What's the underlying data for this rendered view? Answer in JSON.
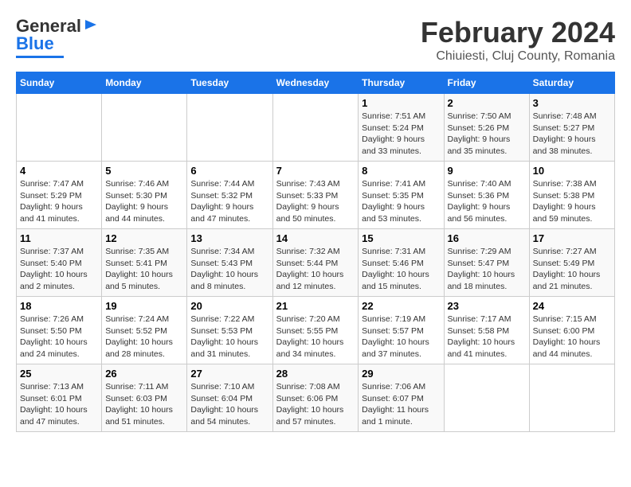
{
  "header": {
    "logo_line1": "General",
    "logo_line2": "Blue",
    "title": "February 2024",
    "subtitle": "Chiuiesti, Cluj County, Romania"
  },
  "weekdays": [
    "Sunday",
    "Monday",
    "Tuesday",
    "Wednesday",
    "Thursday",
    "Friday",
    "Saturday"
  ],
  "weeks": [
    [
      {
        "day": "",
        "info": ""
      },
      {
        "day": "",
        "info": ""
      },
      {
        "day": "",
        "info": ""
      },
      {
        "day": "",
        "info": ""
      },
      {
        "day": "1",
        "info": "Sunrise: 7:51 AM\nSunset: 5:24 PM\nDaylight: 9 hours\nand 33 minutes."
      },
      {
        "day": "2",
        "info": "Sunrise: 7:50 AM\nSunset: 5:26 PM\nDaylight: 9 hours\nand 35 minutes."
      },
      {
        "day": "3",
        "info": "Sunrise: 7:48 AM\nSunset: 5:27 PM\nDaylight: 9 hours\nand 38 minutes."
      }
    ],
    [
      {
        "day": "4",
        "info": "Sunrise: 7:47 AM\nSunset: 5:29 PM\nDaylight: 9 hours\nand 41 minutes."
      },
      {
        "day": "5",
        "info": "Sunrise: 7:46 AM\nSunset: 5:30 PM\nDaylight: 9 hours\nand 44 minutes."
      },
      {
        "day": "6",
        "info": "Sunrise: 7:44 AM\nSunset: 5:32 PM\nDaylight: 9 hours\nand 47 minutes."
      },
      {
        "day": "7",
        "info": "Sunrise: 7:43 AM\nSunset: 5:33 PM\nDaylight: 9 hours\nand 50 minutes."
      },
      {
        "day": "8",
        "info": "Sunrise: 7:41 AM\nSunset: 5:35 PM\nDaylight: 9 hours\nand 53 minutes."
      },
      {
        "day": "9",
        "info": "Sunrise: 7:40 AM\nSunset: 5:36 PM\nDaylight: 9 hours\nand 56 minutes."
      },
      {
        "day": "10",
        "info": "Sunrise: 7:38 AM\nSunset: 5:38 PM\nDaylight: 9 hours\nand 59 minutes."
      }
    ],
    [
      {
        "day": "11",
        "info": "Sunrise: 7:37 AM\nSunset: 5:40 PM\nDaylight: 10 hours\nand 2 minutes."
      },
      {
        "day": "12",
        "info": "Sunrise: 7:35 AM\nSunset: 5:41 PM\nDaylight: 10 hours\nand 5 minutes."
      },
      {
        "day": "13",
        "info": "Sunrise: 7:34 AM\nSunset: 5:43 PM\nDaylight: 10 hours\nand 8 minutes."
      },
      {
        "day": "14",
        "info": "Sunrise: 7:32 AM\nSunset: 5:44 PM\nDaylight: 10 hours\nand 12 minutes."
      },
      {
        "day": "15",
        "info": "Sunrise: 7:31 AM\nSunset: 5:46 PM\nDaylight: 10 hours\nand 15 minutes."
      },
      {
        "day": "16",
        "info": "Sunrise: 7:29 AM\nSunset: 5:47 PM\nDaylight: 10 hours\nand 18 minutes."
      },
      {
        "day": "17",
        "info": "Sunrise: 7:27 AM\nSunset: 5:49 PM\nDaylight: 10 hours\nand 21 minutes."
      }
    ],
    [
      {
        "day": "18",
        "info": "Sunrise: 7:26 AM\nSunset: 5:50 PM\nDaylight: 10 hours\nand 24 minutes."
      },
      {
        "day": "19",
        "info": "Sunrise: 7:24 AM\nSunset: 5:52 PM\nDaylight: 10 hours\nand 28 minutes."
      },
      {
        "day": "20",
        "info": "Sunrise: 7:22 AM\nSunset: 5:53 PM\nDaylight: 10 hours\nand 31 minutes."
      },
      {
        "day": "21",
        "info": "Sunrise: 7:20 AM\nSunset: 5:55 PM\nDaylight: 10 hours\nand 34 minutes."
      },
      {
        "day": "22",
        "info": "Sunrise: 7:19 AM\nSunset: 5:57 PM\nDaylight: 10 hours\nand 37 minutes."
      },
      {
        "day": "23",
        "info": "Sunrise: 7:17 AM\nSunset: 5:58 PM\nDaylight: 10 hours\nand 41 minutes."
      },
      {
        "day": "24",
        "info": "Sunrise: 7:15 AM\nSunset: 6:00 PM\nDaylight: 10 hours\nand 44 minutes."
      }
    ],
    [
      {
        "day": "25",
        "info": "Sunrise: 7:13 AM\nSunset: 6:01 PM\nDaylight: 10 hours\nand 47 minutes."
      },
      {
        "day": "26",
        "info": "Sunrise: 7:11 AM\nSunset: 6:03 PM\nDaylight: 10 hours\nand 51 minutes."
      },
      {
        "day": "27",
        "info": "Sunrise: 7:10 AM\nSunset: 6:04 PM\nDaylight: 10 hours\nand 54 minutes."
      },
      {
        "day": "28",
        "info": "Sunrise: 7:08 AM\nSunset: 6:06 PM\nDaylight: 10 hours\nand 57 minutes."
      },
      {
        "day": "29",
        "info": "Sunrise: 7:06 AM\nSunset: 6:07 PM\nDaylight: 11 hours\nand 1 minute."
      },
      {
        "day": "",
        "info": ""
      },
      {
        "day": "",
        "info": ""
      }
    ]
  ]
}
